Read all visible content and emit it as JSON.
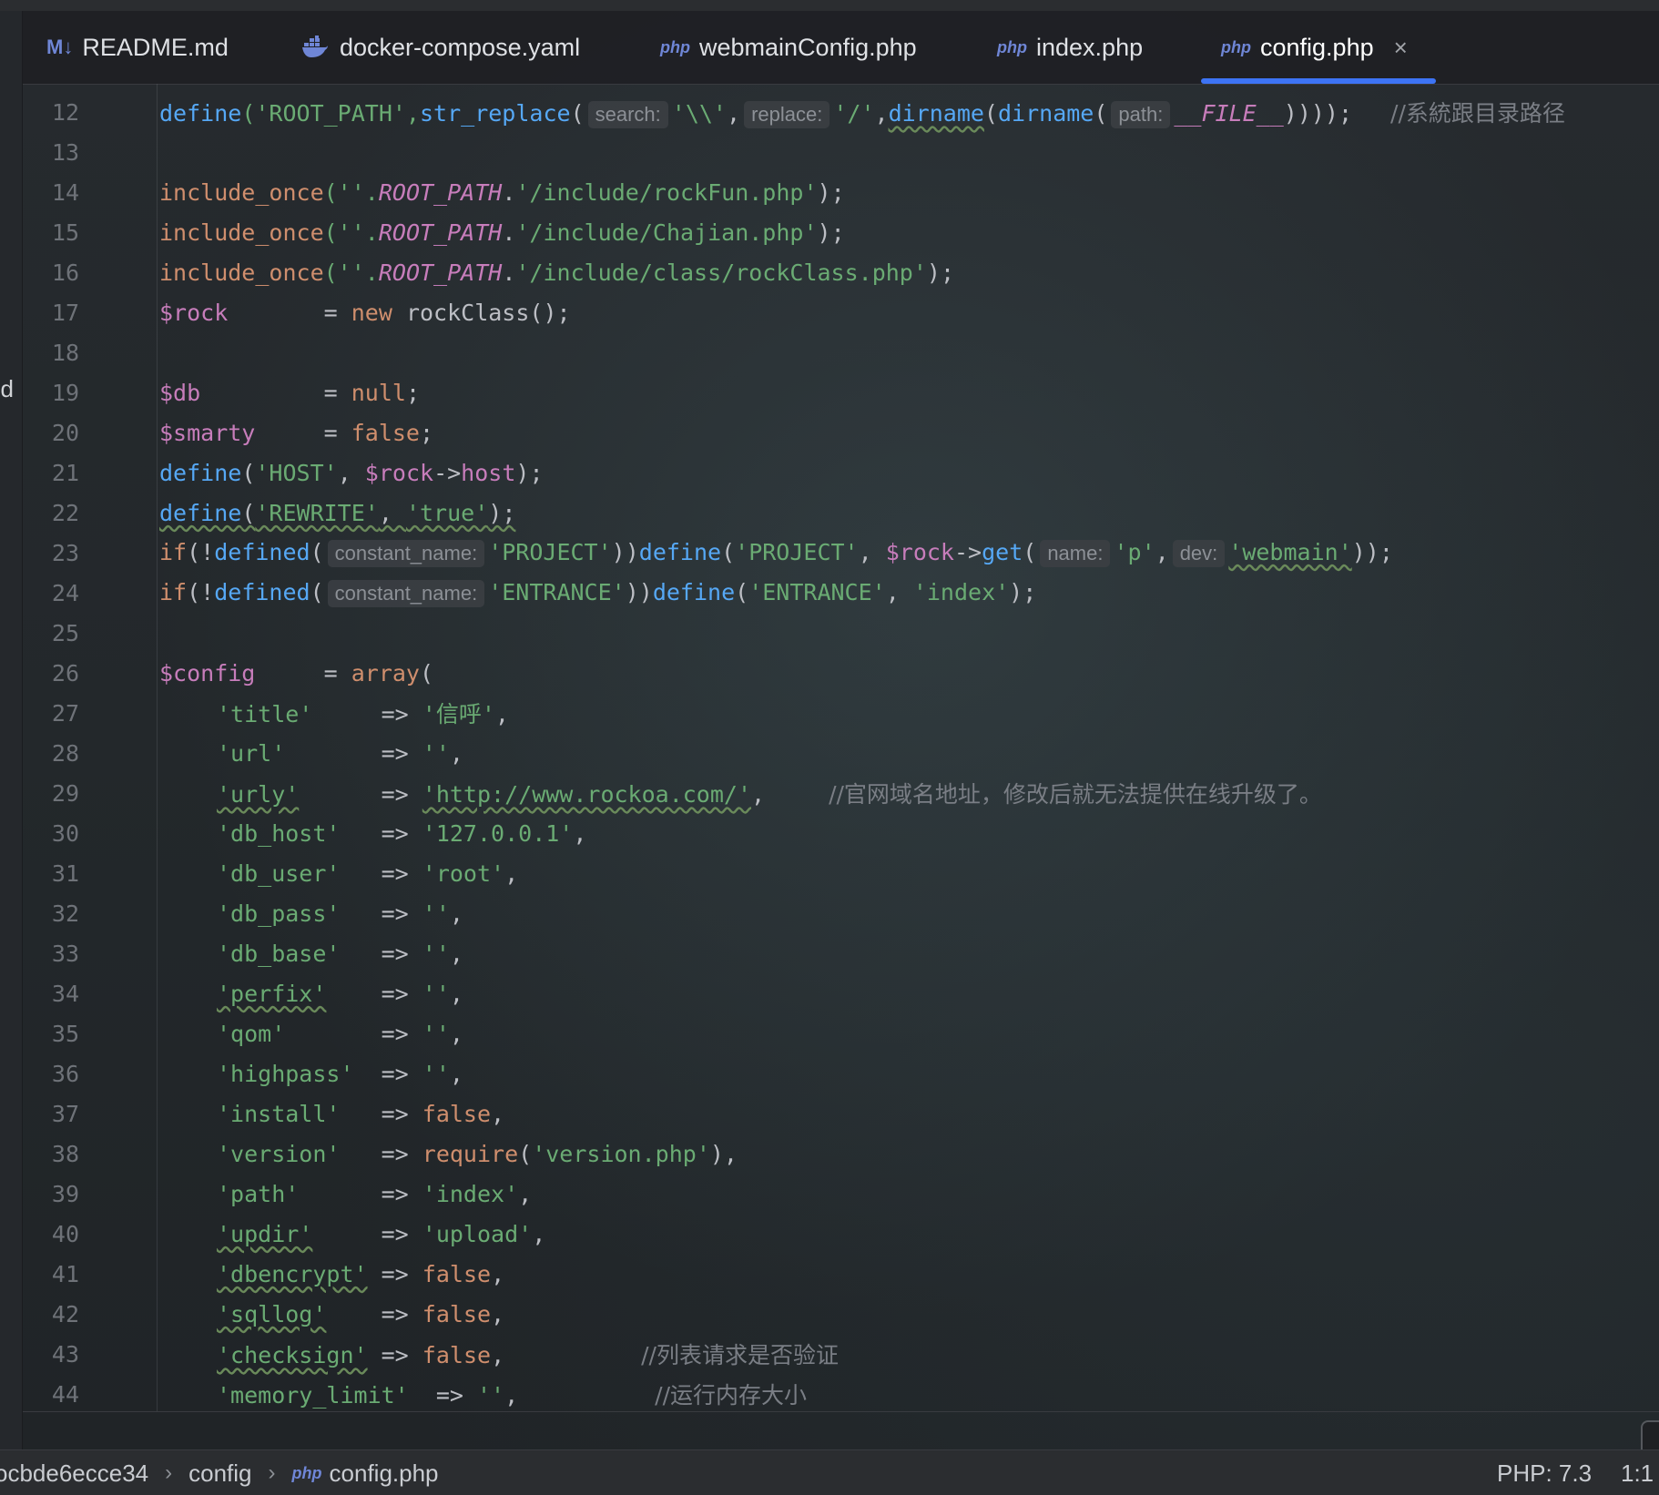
{
  "sidebar": {
    "clipped_text": "od"
  },
  "tabs": [
    {
      "icon": "M↓",
      "label": "README.md"
    },
    {
      "icon": "docker-whale-icon",
      "label": "docker-compose.yaml"
    },
    {
      "icon": "php",
      "label": "webmainConfig.php"
    },
    {
      "icon": "php",
      "label": "index.php"
    },
    {
      "icon": "php",
      "label": "config.php",
      "active": true,
      "close": "×"
    }
  ],
  "code": {
    "line_numbers": [
      "12",
      "13",
      "14",
      "15",
      "16",
      "17",
      "18",
      "19",
      "20",
      "21",
      "22",
      "23",
      "24",
      "25",
      "26",
      "27",
      "28",
      "29",
      "30",
      "31",
      "32",
      "33",
      "34",
      "35",
      "36",
      "37",
      "38",
      "39",
      "40",
      "41",
      "42",
      "43",
      "44"
    ],
    "lines": {
      "l12": {
        "a": "define",
        "b": "('ROOT_PATH',",
        "c": "str_replace",
        "d": "(",
        "h1": "search:",
        "e": "'\\\\'",
        "f": ",",
        "h2": "replace:",
        "g": "'/'",
        "h": ",",
        "i": "dirname",
        "j": "(",
        "k": "dirname",
        "l": "(",
        "h3": "path:",
        "m": "__FILE__",
        "n": "))));",
        "cm": "//系統跟目录路径"
      },
      "l14": {
        "a": "include_once",
        "b": "(''.",
        "c": "ROOT_PATH",
        "d": ".",
        "e": "'/include/rockFun.php'",
        "f": ");"
      },
      "l15": {
        "a": "include_once",
        "b": "(''.",
        "c": "ROOT_PATH",
        "d": ".",
        "e": "'/include/Chajian.php'",
        "f": ");"
      },
      "l16": {
        "a": "include_once",
        "b": "(''.",
        "c": "ROOT_PATH",
        "d": ".",
        "e": "'/include/class/rockClass.php'",
        "f": ");"
      },
      "l17": {
        "a": "$rock",
        "b": "       = ",
        "c": "new",
        "d": " rockClass();"
      },
      "l19": {
        "a": "$db",
        "b": "         = ",
        "c": "null",
        "d": ";"
      },
      "l20": {
        "a": "$smarty",
        "b": "     = ",
        "c": "false",
        "d": ";"
      },
      "l21": {
        "a": "define",
        "b": "(",
        "c": "'HOST'",
        "d": ", ",
        "e": "$rock",
        "f": "->",
        "g": "host",
        "h": ");"
      },
      "l22": {
        "a": "define",
        "b": "(",
        "c": "'REWRITE'",
        "d": ", ",
        "e": "'true'",
        "f": ");"
      },
      "l23": {
        "a": "if",
        "b": "(!",
        "c": "defined",
        "d": "(",
        "h1": "constant_name:",
        "e": "'PROJECT'",
        "f": "))",
        "g": "define",
        "h": "(",
        "i": "'PROJECT'",
        "j": ", ",
        "k": "$rock",
        "l": "->",
        "m": "get",
        "n": "(",
        "h2": "name:",
        "o": "'p'",
        "p": ",",
        "h3": "dev:",
        "q": "'webmain'",
        "r": "));"
      },
      "l24": {
        "a": "if",
        "b": "(!",
        "c": "defined",
        "d": "(",
        "h1": "constant_name:",
        "e": "'ENTRANCE'",
        "f": "))",
        "g": "define",
        "h": "(",
        "i": "'ENTRANCE'",
        "j": ", ",
        "k": "'index'",
        "l": ");"
      },
      "l26": {
        "a": "$config",
        "b": "     = ",
        "c": "array",
        "d": "("
      },
      "l27": {
        "k": "'title'",
        "op": "     => ",
        "v": "'信呼'",
        "e": ","
      },
      "l28": {
        "k": "'url'",
        "op": "       => ",
        "v": "''",
        "e": ","
      },
      "l29": {
        "k": "'urly'",
        "op": "      => ",
        "v": "'http://www.rockoa.com/'",
        "e": ",",
        "cm": "//官网域名地址，修改后就无法提供在线升级了。"
      },
      "l30": {
        "k": "'db_host'",
        "op": "   => ",
        "v": "'127.0.0.1'",
        "e": ","
      },
      "l31": {
        "k": "'db_user'",
        "op": "   => ",
        "v": "'root'",
        "e": ","
      },
      "l32": {
        "k": "'db_pass'",
        "op": "   => ",
        "v": "''",
        "e": ","
      },
      "l33": {
        "k": "'db_base'",
        "op": "   => ",
        "v": "''",
        "e": ","
      },
      "l34": {
        "k": "'perfix'",
        "op": "    => ",
        "v": "''",
        "e": ","
      },
      "l35": {
        "k": "'qom'",
        "op": "       => ",
        "v": "''",
        "e": ","
      },
      "l36": {
        "k": "'highpass'",
        "op": "  => ",
        "v": "''",
        "e": ","
      },
      "l37": {
        "k": "'install'",
        "op": "   => ",
        "v": "false",
        "e": ","
      },
      "l38": {
        "k": "'version'",
        "op": "   => ",
        "f": "require",
        "p1": "(",
        "v": "'version.php'",
        "e": "),"
      },
      "l39": {
        "k": "'path'",
        "op": "      => ",
        "v": "'index'",
        "e": ","
      },
      "l40": {
        "k": "'updir'",
        "op": "     => ",
        "v": "'upload'",
        "e": ","
      },
      "l41": {
        "k": "'dbencrypt'",
        "op": " => ",
        "v": "false",
        "e": ","
      },
      "l42": {
        "k": "'sqllog'",
        "op": "    => ",
        "v": "false",
        "e": ","
      },
      "l43": {
        "k": "'checksign'",
        "op": " => ",
        "v": "false",
        "e": ",",
        "cm": "//列表请求是否验证"
      },
      "l44": {
        "k": "'memory_limit'",
        "op": "  => ",
        "v": "''",
        "e": ",",
        "cm": "//运行内存大小"
      }
    }
  },
  "statusbar": {
    "breadcrumb": [
      "ocbde6ecce34",
      "config",
      "config.php"
    ],
    "breadcrumb_sep": "›",
    "php_icon": "php",
    "php_version": "PHP: 7.3",
    "cursor": "1:1"
  },
  "colors": {
    "keyword": "#cf8e6d",
    "function": "#56a8f5",
    "string": "#6aab73",
    "variable": "#c77dbb",
    "comment": "#7a7e85",
    "accent": "#3d74f5"
  }
}
